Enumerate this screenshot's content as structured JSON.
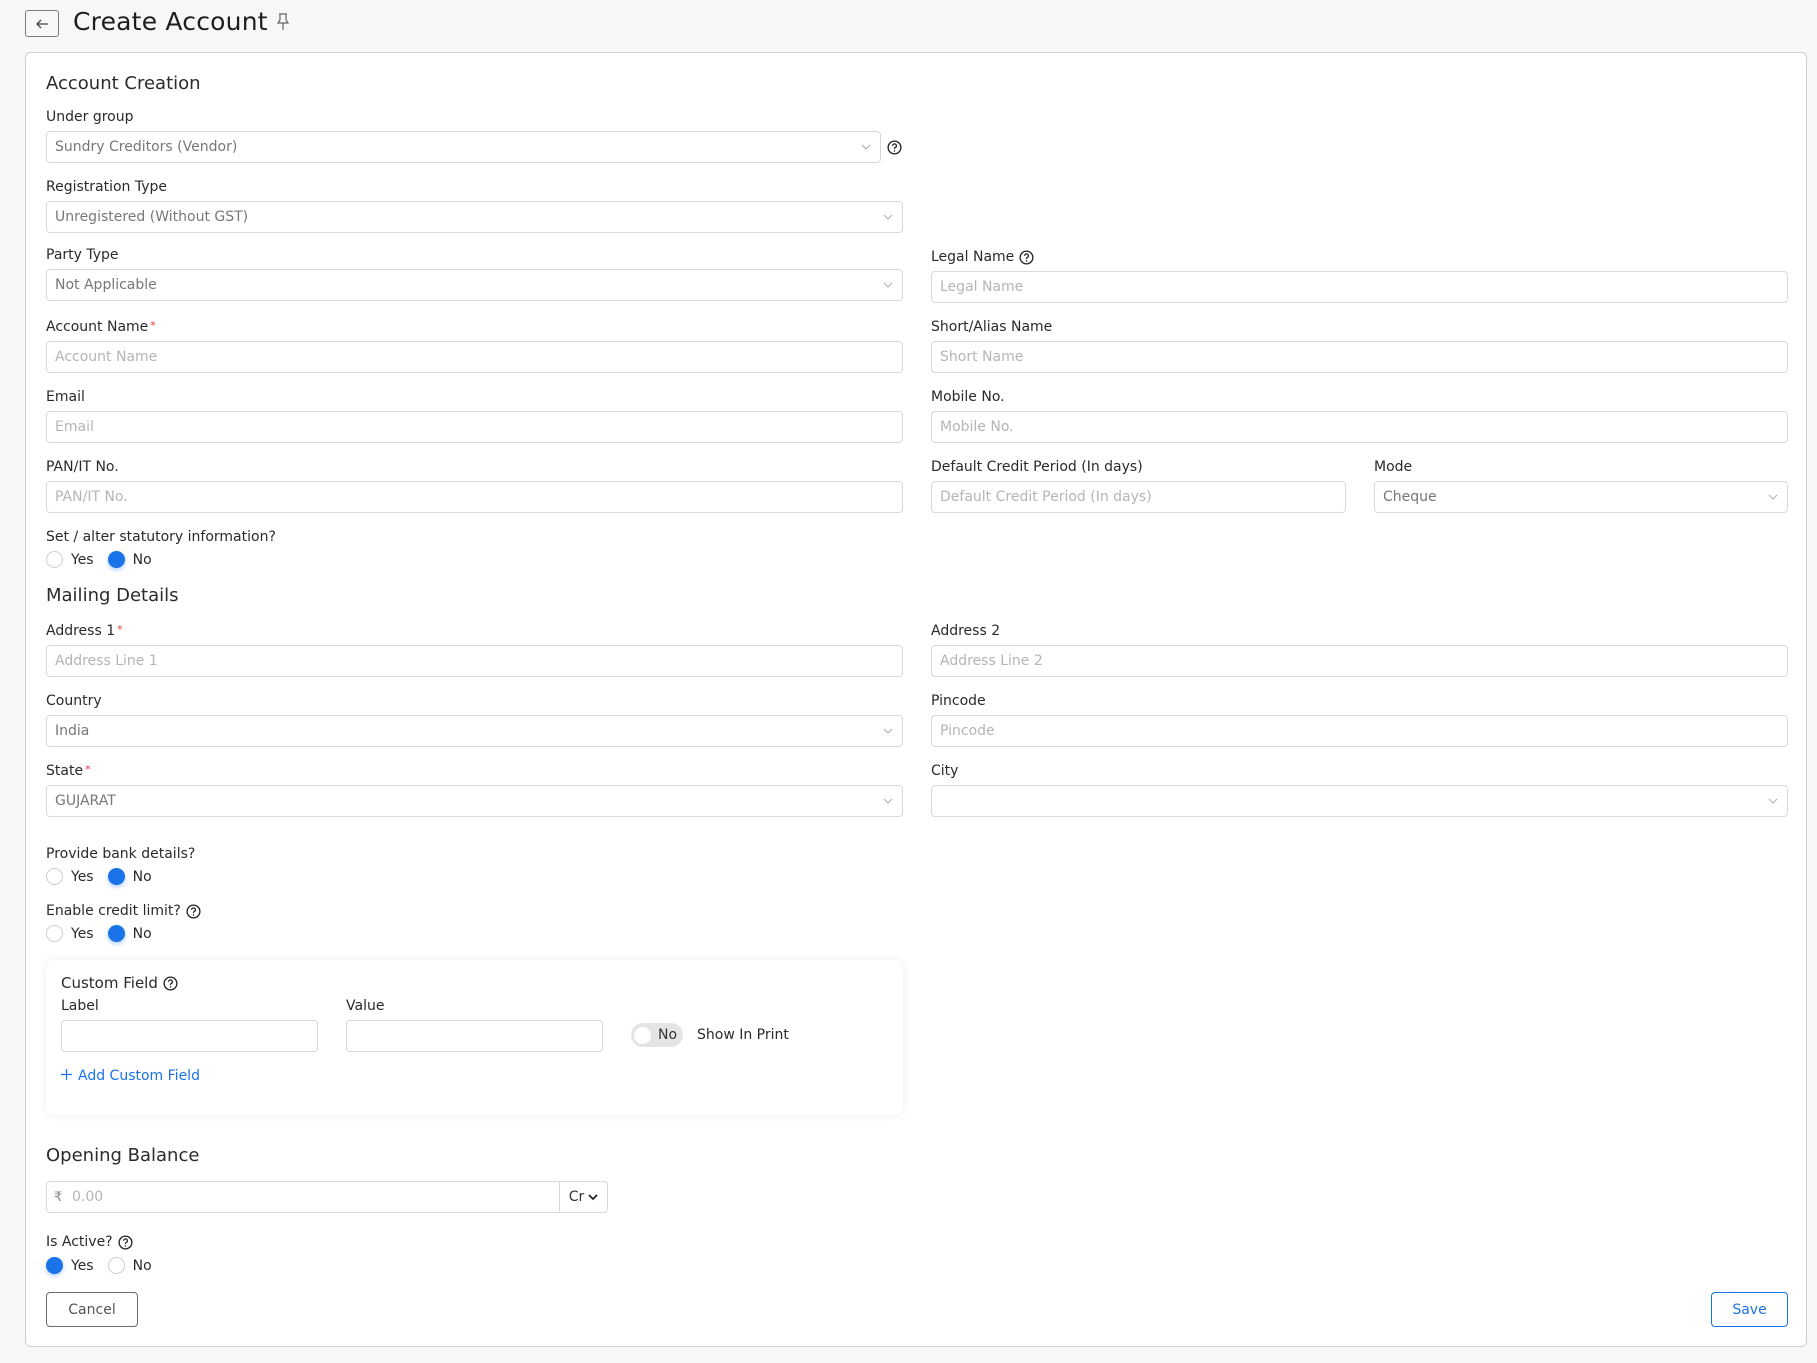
{
  "header": {
    "title": "Create Account",
    "back_icon": "arrow-left-icon",
    "pin_icon": "pin-icon"
  },
  "sections": {
    "account_creation": "Account Creation",
    "mailing_details": "Mailing Details",
    "opening_balance": "Opening Balance"
  },
  "fields": {
    "under_group": {
      "label": "Under group",
      "value": "Sundry Creditors (Vendor)"
    },
    "registration_type": {
      "label": "Registration Type",
      "value": "Unregistered (Without GST)"
    },
    "party_type": {
      "label": "Party Type",
      "value": "Not Applicable"
    },
    "legal_name": {
      "label": "Legal Name",
      "placeholder": "Legal Name"
    },
    "account_name": {
      "label": "Account Name",
      "placeholder": "Account Name",
      "required_mark": "*"
    },
    "short_name": {
      "label": "Short/Alias Name",
      "placeholder": "Short Name"
    },
    "email": {
      "label": "Email",
      "placeholder": "Email"
    },
    "mobile": {
      "label": "Mobile No.",
      "placeholder": "Mobile No."
    },
    "pan": {
      "label": "PAN/IT No.",
      "placeholder": "PAN/IT No."
    },
    "credit_period": {
      "label": "Default Credit Period (In days)",
      "placeholder": "Default Credit Period (In days)"
    },
    "mode": {
      "label": "Mode",
      "value": "Cheque"
    },
    "address1": {
      "label": "Address 1",
      "placeholder": "Address Line 1",
      "required_mark": "*"
    },
    "address2": {
      "label": "Address 2",
      "placeholder": "Address Line 2"
    },
    "country": {
      "label": "Country",
      "value": "India"
    },
    "pincode": {
      "label": "Pincode",
      "placeholder": "Pincode"
    },
    "state": {
      "label": "State",
      "value": "GUJARAT",
      "required_mark": "*"
    },
    "city": {
      "label": "City",
      "value": ""
    }
  },
  "radios": {
    "statutory": {
      "label": "Set / alter statutory information?",
      "yes": "Yes",
      "no": "No",
      "selected": "No"
    },
    "bank_details": {
      "label": "Provide bank details?",
      "yes": "Yes",
      "no": "No",
      "selected": "No"
    },
    "credit_limit": {
      "label": "Enable credit limit?",
      "yes": "Yes",
      "no": "No",
      "selected": "No"
    },
    "is_active": {
      "label": "Is Active?",
      "yes": "Yes",
      "no": "No",
      "selected": "Yes"
    }
  },
  "custom_field": {
    "title": "Custom Field",
    "label_col": "Label",
    "value_col": "Value",
    "label_value": "",
    "value_value": "",
    "toggle_text": "No",
    "show_in_print": "Show In Print",
    "add_link": "Add Custom Field"
  },
  "opening_balance": {
    "currency_symbol": "₹",
    "placeholder": "0.00",
    "type": "Cr"
  },
  "buttons": {
    "cancel": "Cancel",
    "save": "Save"
  },
  "colors": {
    "accent": "#1a73e8",
    "required": "#e53935"
  }
}
